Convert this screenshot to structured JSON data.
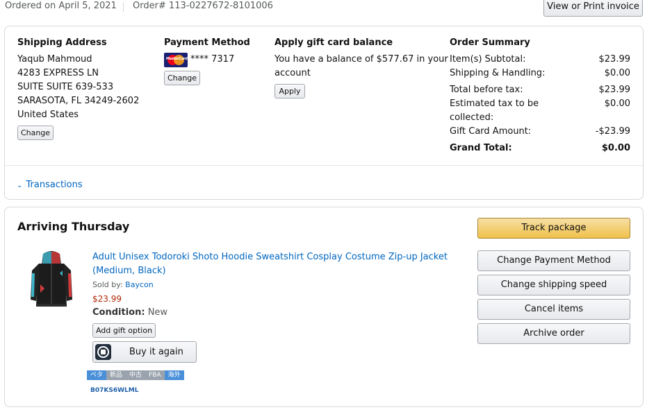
{
  "header": {
    "ordered_on": "Ordered on April 5, 2021",
    "order_number": "Order# 113-0227672-8101006",
    "invoice_button": "View or Print invoice"
  },
  "shipping": {
    "heading": "Shipping Address",
    "lines": [
      "Yaqub Mahmoud",
      "4283 EXPRESS LN",
      "SUITE SUITE 639-533",
      "SARASOTA, FL 34249-2602",
      "United States"
    ],
    "change_button": "Change"
  },
  "payment": {
    "heading": "Payment Method",
    "card_logo_text": "MasterCard",
    "card_masked": "**** 7317",
    "change_button": "Change"
  },
  "gift_card": {
    "heading": "Apply gift card balance",
    "text_line1": "You have a balance of $577.67 in your",
    "text_line2": "account",
    "apply_button": "Apply"
  },
  "summary": {
    "heading": "Order Summary",
    "subtotal_label": "Item(s) Subtotal:",
    "subtotal_value": "$23.99",
    "shipping_label": "Shipping & Handling:",
    "shipping_value": "$0.00",
    "before_tax_label": "Total before tax:",
    "before_tax_value": "$23.99",
    "est_tax_label_1": "Estimated tax to be",
    "est_tax_label_2": "collected:",
    "est_tax_value": "$0.00",
    "gift_card_label": "Gift Card Amount:",
    "gift_card_value": "-$23.99",
    "grand_total_label": "Grand Total:",
    "grand_total_value": "$0.00"
  },
  "transactions": {
    "label": "Transactions"
  },
  "shipment": {
    "status": "Arriving Thursday",
    "track_button": "Track package",
    "actions": [
      "Change Payment Method",
      "Change shipping speed",
      "Cancel items",
      "Archive order"
    ]
  },
  "item": {
    "title_line1": "Adult Unisex Todoroki Shoto Hoodie Sweatshirt Cosplay Costume Zip-up Jacket",
    "title_line2": "(Medium, Black)",
    "sold_by_label": "Sold by:",
    "seller": "Baycon",
    "price": "$23.99",
    "condition_label": "Condition:",
    "condition_value": "New",
    "gift_option_button": "Add gift option",
    "buy_again_button": "Buy it again",
    "tags": [
      "ベタ",
      "新品",
      "中古",
      "FBA",
      "海外"
    ],
    "asin": "B07KS6WLML"
  },
  "colors": {
    "link": "#0066c0",
    "price": "#b12704",
    "track_button": "#f0c14b",
    "border": "#d5d9d9"
  }
}
